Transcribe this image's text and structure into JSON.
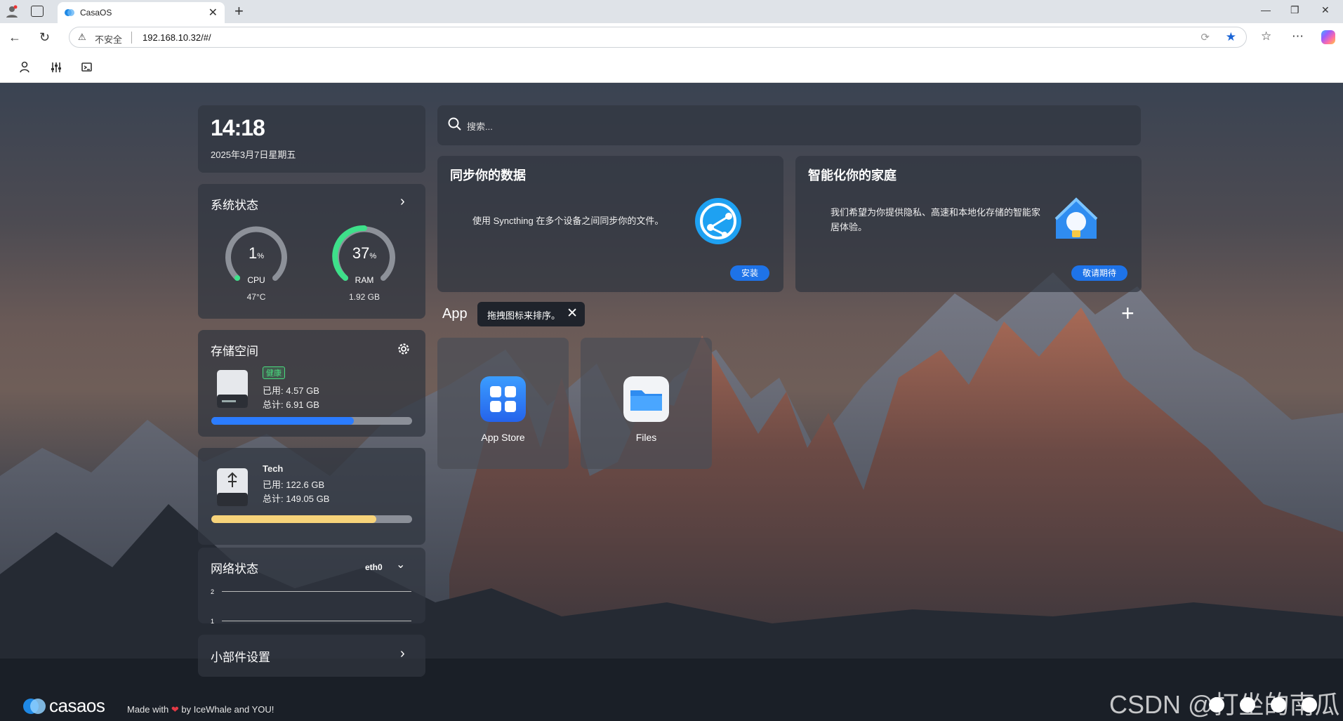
{
  "browser": {
    "tab_title": "CasaOS",
    "insecure_label": "不安全",
    "url": "192.168.10.32/#/"
  },
  "clock": {
    "time": "14:18",
    "date": "2025年3月7日星期五"
  },
  "system_status": {
    "title": "系统状态",
    "cpu": {
      "value": "1",
      "unit": "%",
      "label": "CPU",
      "sub": "47°C",
      "percent": 1
    },
    "ram": {
      "value": "37",
      "unit": "%",
      "label": "RAM",
      "sub": "1.92 GB",
      "percent": 37
    }
  },
  "storage": {
    "title": "存储空间",
    "badge": "健康",
    "used": "已用: 4.57 GB",
    "total": "总计: 6.91 GB",
    "fill_percent": 71,
    "fill_color": "#2b7cff"
  },
  "usb": {
    "name": "Tech",
    "used": "已用: 122.6 GB",
    "total": "总计: 149.05 GB",
    "fill_percent": 82,
    "fill_color": "#f7d37a"
  },
  "network": {
    "title": "网络状态",
    "iface": "eth0",
    "tick_top": "2",
    "tick_bottom": "1"
  },
  "widget_settings": {
    "title": "小部件设置"
  },
  "search": {
    "placeholder": "搜索..."
  },
  "promo_sync": {
    "title": "同步你的数据",
    "desc": "使用 Syncthing 在多个设备之间同步你的文件。",
    "button": "安装"
  },
  "promo_home": {
    "title": "智能化你的家庭",
    "desc": "我们希望为你提供隐私、高速和本地化存储的智能家居体验。",
    "button": "敬请期待"
  },
  "apps": {
    "label": "App",
    "tooltip": "拖拽图标来排序。",
    "items": [
      {
        "name": "App Store",
        "icon": "app-store-icon"
      },
      {
        "name": "Files",
        "icon": "files-folder-icon"
      }
    ]
  },
  "footer": {
    "logo_text": "casaos",
    "made_with": "Made with",
    "by": "by IceWhale and YOU!",
    "watermark": "CSDN @打坐的南瓜"
  }
}
